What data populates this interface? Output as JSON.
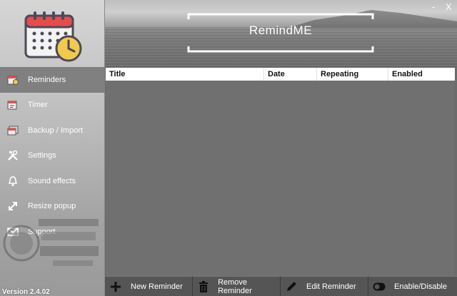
{
  "app": {
    "banner_title": "RemindME",
    "version": "Version 2.4.02"
  },
  "window": {
    "minimize": "-",
    "close": "X"
  },
  "sidebar": {
    "items": [
      {
        "label": "Reminders",
        "icon": "reminder-list-icon",
        "active": true
      },
      {
        "label": "Timer",
        "icon": "timer-icon"
      },
      {
        "label": "Backup / Import",
        "icon": "backup-icon"
      },
      {
        "label": "Settings",
        "icon": "settings-tools-icon"
      },
      {
        "label": "Sound effects",
        "icon": "bell-icon"
      },
      {
        "label": "Resize popup",
        "icon": "resize-icon"
      },
      {
        "label": "Support",
        "icon": "mail-icon"
      }
    ]
  },
  "table": {
    "columns": [
      "Title",
      "Date",
      "Repeating",
      "Enabled"
    ],
    "rows": []
  },
  "toolbar": {
    "new": "New Reminder",
    "remove": "Remove Reminder",
    "edit": "Edit Reminder",
    "toggle": "Enable/Disable"
  },
  "colors": {
    "accent_red": "#e74c4c",
    "clock_yellow": "#f2c94c",
    "sidebar_active": "#808080"
  }
}
